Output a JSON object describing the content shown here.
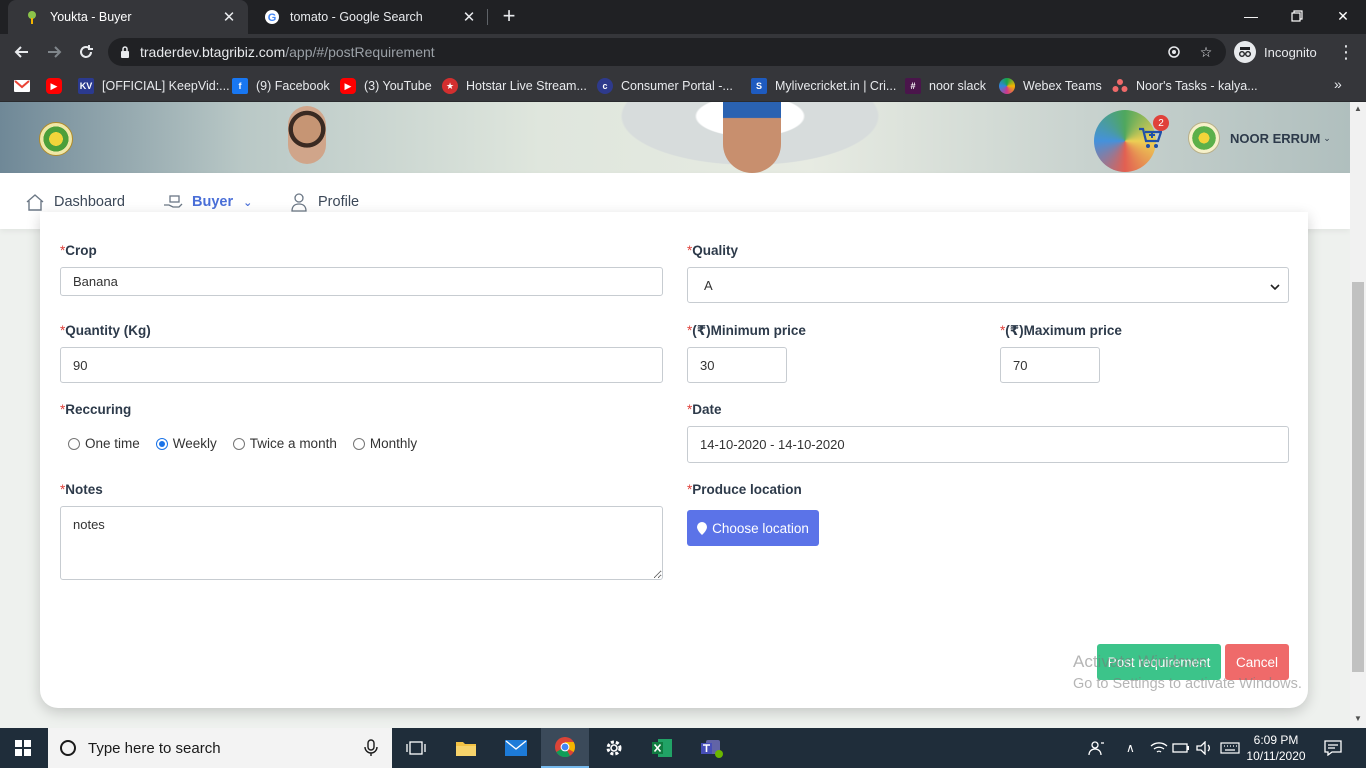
{
  "browser": {
    "tabs": [
      {
        "title": "Youkta - Buyer",
        "active": true
      },
      {
        "title": "tomato - Google Search",
        "active": false
      }
    ],
    "url_host": "traderdev.btagribiz.com",
    "url_path": "/app/#/postRequirement",
    "profile_label": "Incognito",
    "bookmarks": [
      {
        "label": "",
        "icon": "gmail-icon",
        "color": "#ea4335"
      },
      {
        "label": "",
        "icon": "youtube-icon",
        "color": "#ff0000"
      },
      {
        "label": "[OFFICIAL] KeepVid:...",
        "icon": "keepvid-icon",
        "color": "#2b3a8f"
      },
      {
        "label": "(9) Facebook",
        "icon": "facebook-icon",
        "color": "#1877f2"
      },
      {
        "label": "(3) YouTube",
        "icon": "youtube-icon",
        "color": "#ff0000"
      },
      {
        "label": "Hotstar Live Stream...",
        "icon": "hotstar-icon",
        "color": "#d32f2f"
      },
      {
        "label": "Consumer Portal -...",
        "icon": "portal-icon",
        "color": "#2e3a8c"
      },
      {
        "label": "Mylivecricket.in | Cri...",
        "icon": "mylivecricket-icon",
        "color": "#1e5bbf"
      },
      {
        "label": "noor slack",
        "icon": "slack-icon",
        "color": "#4a154b"
      },
      {
        "label": "Webex Teams",
        "icon": "webex-icon",
        "color": "#17a34a"
      },
      {
        "label": "Noor's Tasks - kalya...",
        "icon": "asana-icon",
        "color": "#f06a6a"
      }
    ]
  },
  "header": {
    "user_name": "NOOR ERRUM",
    "cart_count": "2"
  },
  "nav": {
    "items": [
      {
        "label": "Dashboard"
      },
      {
        "label": "Buyer"
      },
      {
        "label": "Profile"
      }
    ]
  },
  "form": {
    "required_mark": "*",
    "crop": {
      "label": "Crop",
      "value": "Banana"
    },
    "quality": {
      "label": "Quality",
      "value": "A"
    },
    "quantity": {
      "label": "Quantity (Kg)",
      "value": "90"
    },
    "min_price": {
      "label": "(₹)Minimum price",
      "value": "30"
    },
    "max_price": {
      "label": "(₹)Maximum price",
      "value": "70"
    },
    "recurring": {
      "label": "Reccuring",
      "options": [
        "One time",
        "Weekly",
        "Twice a month",
        "Monthly"
      ],
      "selected": "Weekly"
    },
    "date": {
      "label": "Date",
      "value": "14-10-2020 - 14-10-2020"
    },
    "notes": {
      "label": "Notes",
      "value": "notes"
    },
    "produce_location": {
      "label": "Produce location",
      "button": "Choose location"
    },
    "post_button": "Post requirement",
    "cancel_button": "Cancel"
  },
  "watermark": {
    "line1": "Activate Windows",
    "line2": "Go to Settings to activate Windows."
  },
  "taskbar": {
    "search_placeholder": "Type here to search",
    "time": "6:09 PM",
    "date": "10/11/2020"
  }
}
